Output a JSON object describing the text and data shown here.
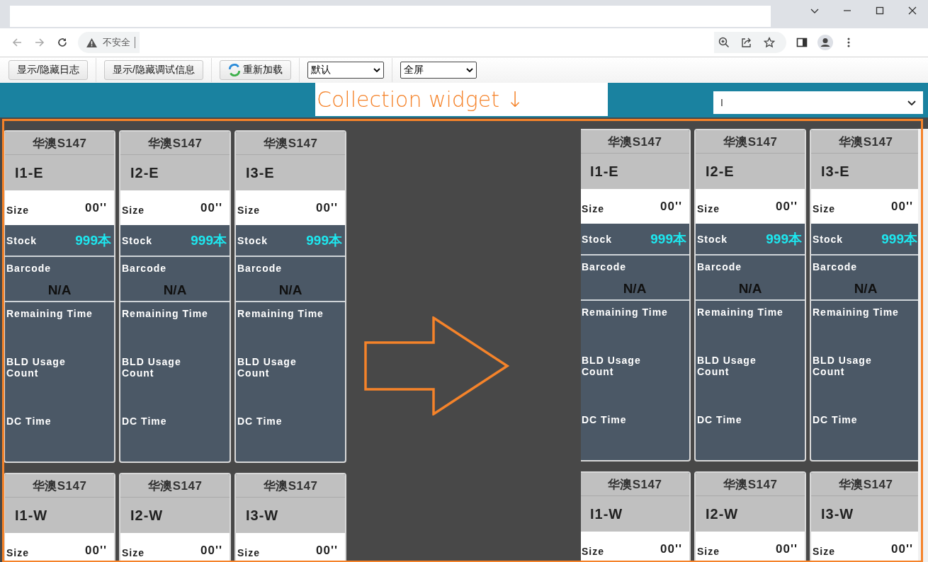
{
  "browser": {
    "security_label": "不安全"
  },
  "toolbar": {
    "buttons": [
      {
        "label": "显示/隐藏日志",
        "kind": "plain"
      },
      {
        "label": "显示/隐藏调试信息",
        "kind": "plain"
      },
      {
        "label": "重新加载",
        "kind": "reload"
      }
    ],
    "selects": [
      {
        "value": "默认"
      },
      {
        "value": "全屏"
      }
    ]
  },
  "header": {
    "annotation": "Collection widget ↓",
    "select_value": "I"
  },
  "panels": [
    {
      "cards": [
        {
          "brand": "华澳S147",
          "code": "I1-E",
          "size_label": "Size",
          "size_value": "00''",
          "stock_label": "Stock",
          "stock_value": "999本",
          "barcode_label": "Barcode",
          "barcode_value": "N/A",
          "remaining_label": "Remaining Time",
          "usage_label": "BLD Usage Count",
          "dc_label": "DC Time"
        },
        {
          "brand": "华澳S147",
          "code": "I2-E",
          "size_label": "Size",
          "size_value": "00''",
          "stock_label": "Stock",
          "stock_value": "999本",
          "barcode_label": "Barcode",
          "barcode_value": "N/A",
          "remaining_label": "Remaining Time",
          "usage_label": "BLD Usage Count",
          "dc_label": "DC Time"
        },
        {
          "brand": "华澳S147",
          "code": "I3-E",
          "size_label": "Size",
          "size_value": "00''",
          "stock_label": "Stock",
          "stock_value": "999本",
          "barcode_label": "Barcode",
          "barcode_value": "N/A",
          "remaining_label": "Remaining Time",
          "usage_label": "BLD Usage Count",
          "dc_label": "DC Time"
        },
        {
          "brand": "华澳S147",
          "code": "I1-W",
          "size_label": "Size",
          "size_value": "00''"
        },
        {
          "brand": "华澳S147",
          "code": "I2-W",
          "size_label": "Size",
          "size_value": "00''"
        },
        {
          "brand": "华澳S147",
          "code": "I3-W",
          "size_label": "Size",
          "size_value": "00''"
        }
      ]
    },
    {
      "cards": [
        {
          "brand": "华澳S147",
          "code": "I1-E",
          "size_label": "Size",
          "size_value": "00''",
          "stock_label": "Stock",
          "stock_value": "999本",
          "barcode_label": "Barcode",
          "barcode_value": "N/A",
          "remaining_label": "Remaining Time",
          "usage_label": "BLD Usage Count",
          "dc_label": "DC Time"
        },
        {
          "brand": "华澳S147",
          "code": "I2-E",
          "size_label": "Size",
          "size_value": "00''",
          "stock_label": "Stock",
          "stock_value": "999本",
          "barcode_label": "Barcode",
          "barcode_value": "N/A",
          "remaining_label": "Remaining Time",
          "usage_label": "BLD Usage Count",
          "dc_label": "DC Time"
        },
        {
          "brand": "华澳S147",
          "code": "I3-E",
          "size_label": "Size",
          "size_value": "00''",
          "stock_label": "Stock",
          "stock_value": "999本",
          "barcode_label": "Barcode",
          "barcode_value": "N/A",
          "remaining_label": "Remaining Time",
          "usage_label": "BLD Usage Count",
          "dc_label": "DC Time"
        },
        {
          "brand": "华澳S147",
          "code": "I1-W",
          "size_label": "Size",
          "size_value": "00''"
        },
        {
          "brand": "华澳S147",
          "code": "I2-W",
          "size_label": "Size",
          "size_value": "00''"
        },
        {
          "brand": "华澳S147",
          "code": "I3-W",
          "size_label": "Size",
          "size_value": "00''"
        }
      ]
    }
  ]
}
